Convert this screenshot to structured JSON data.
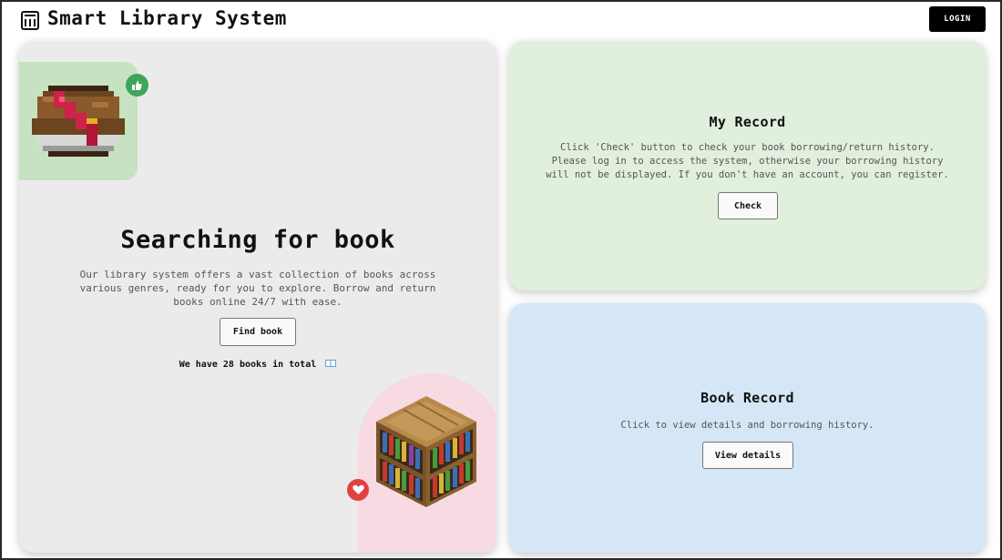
{
  "header": {
    "logo_icon": "library-building-icon",
    "title": "Smart Library System",
    "login_label": "LOGIN"
  },
  "search_card": {
    "title": "Searching for book",
    "description": "Our library system offers a vast collection of books across various genres, ready for you to explore. Borrow and return books online 24/7 with ease.",
    "button_label": "Find book",
    "count_text": "We have 28 books in total",
    "count_icon": "open-book-icon",
    "badges": [
      "thumbs-up-icon",
      "heart-icon"
    ],
    "colors": {
      "card": "#ebebeb",
      "green_tile": "#c6e2c0",
      "pink_arch": "#f7dae2",
      "thumb_badge": "#3ea55a",
      "heart_badge": "#e04141"
    }
  },
  "record_card": {
    "title": "My Record",
    "description": "Click 'Check' button to check your book borrowing/return history. Please log in to access the system, otherwise your borrowing history will not be displayed. If you don't have an account, you can register.",
    "button_label": "Check",
    "color": "#e1efdd"
  },
  "book_record_card": {
    "title": "Book Record",
    "description": "Click to view details and borrowing history.",
    "button_label": "View details",
    "color": "#d5e7f6"
  }
}
